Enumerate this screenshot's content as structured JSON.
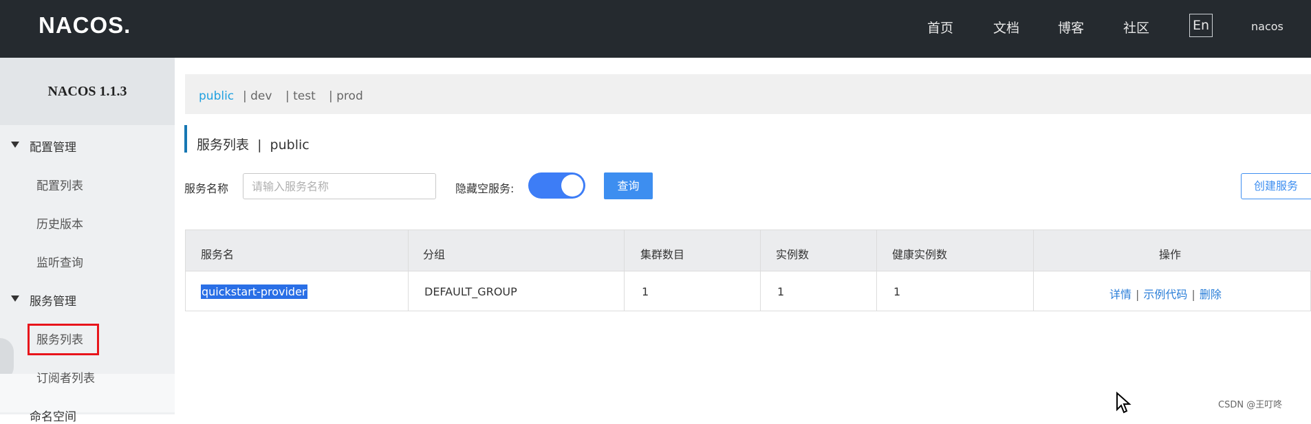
{
  "header": {
    "logo": "NACOS.",
    "nav": [
      "首页",
      "文档",
      "博客",
      "社区"
    ],
    "lang": "En",
    "user": "nacos"
  },
  "sidebar": {
    "title": "NACOS 1.1.3",
    "groups": [
      {
        "label": "配置管理",
        "items": [
          "配置列表",
          "历史版本",
          "监听查询"
        ]
      },
      {
        "label": "服务管理",
        "items": [
          "服务列表",
          "订阅者列表"
        ]
      },
      {
        "label": "命名空间",
        "items": []
      }
    ],
    "active_item": "服务列表"
  },
  "namespaces": {
    "items": [
      "public",
      "| dev",
      "| test",
      "| prod"
    ],
    "active": "public"
  },
  "page": {
    "title": "服务列表  |  public"
  },
  "filters": {
    "service_name_label": "服务名称",
    "service_name_placeholder": "请输入服务名称",
    "service_name_value": "",
    "hide_empty_label": "隐藏空服务:",
    "hide_empty_on": true,
    "query_label": "查询",
    "create_label": "创建服务"
  },
  "table": {
    "columns": [
      "服务名",
      "分组",
      "集群数目",
      "实例数",
      "健康实例数",
      "操作"
    ],
    "rows": [
      {
        "service": "quickstart-provider",
        "group": "DEFAULT_GROUP",
        "clusters": "1",
        "instances": "1",
        "healthy": "1",
        "ops": [
          "详情",
          "示例代码",
          "删除"
        ]
      }
    ]
  },
  "watermark": "CSDN @王叮咚",
  "colors": {
    "topbar": "#252a2f",
    "accent": "#3d8ef0",
    "toggle_on": "#3d7df6",
    "highlight_box": "#e8141b",
    "namespace_active": "#1ea0e0"
  }
}
